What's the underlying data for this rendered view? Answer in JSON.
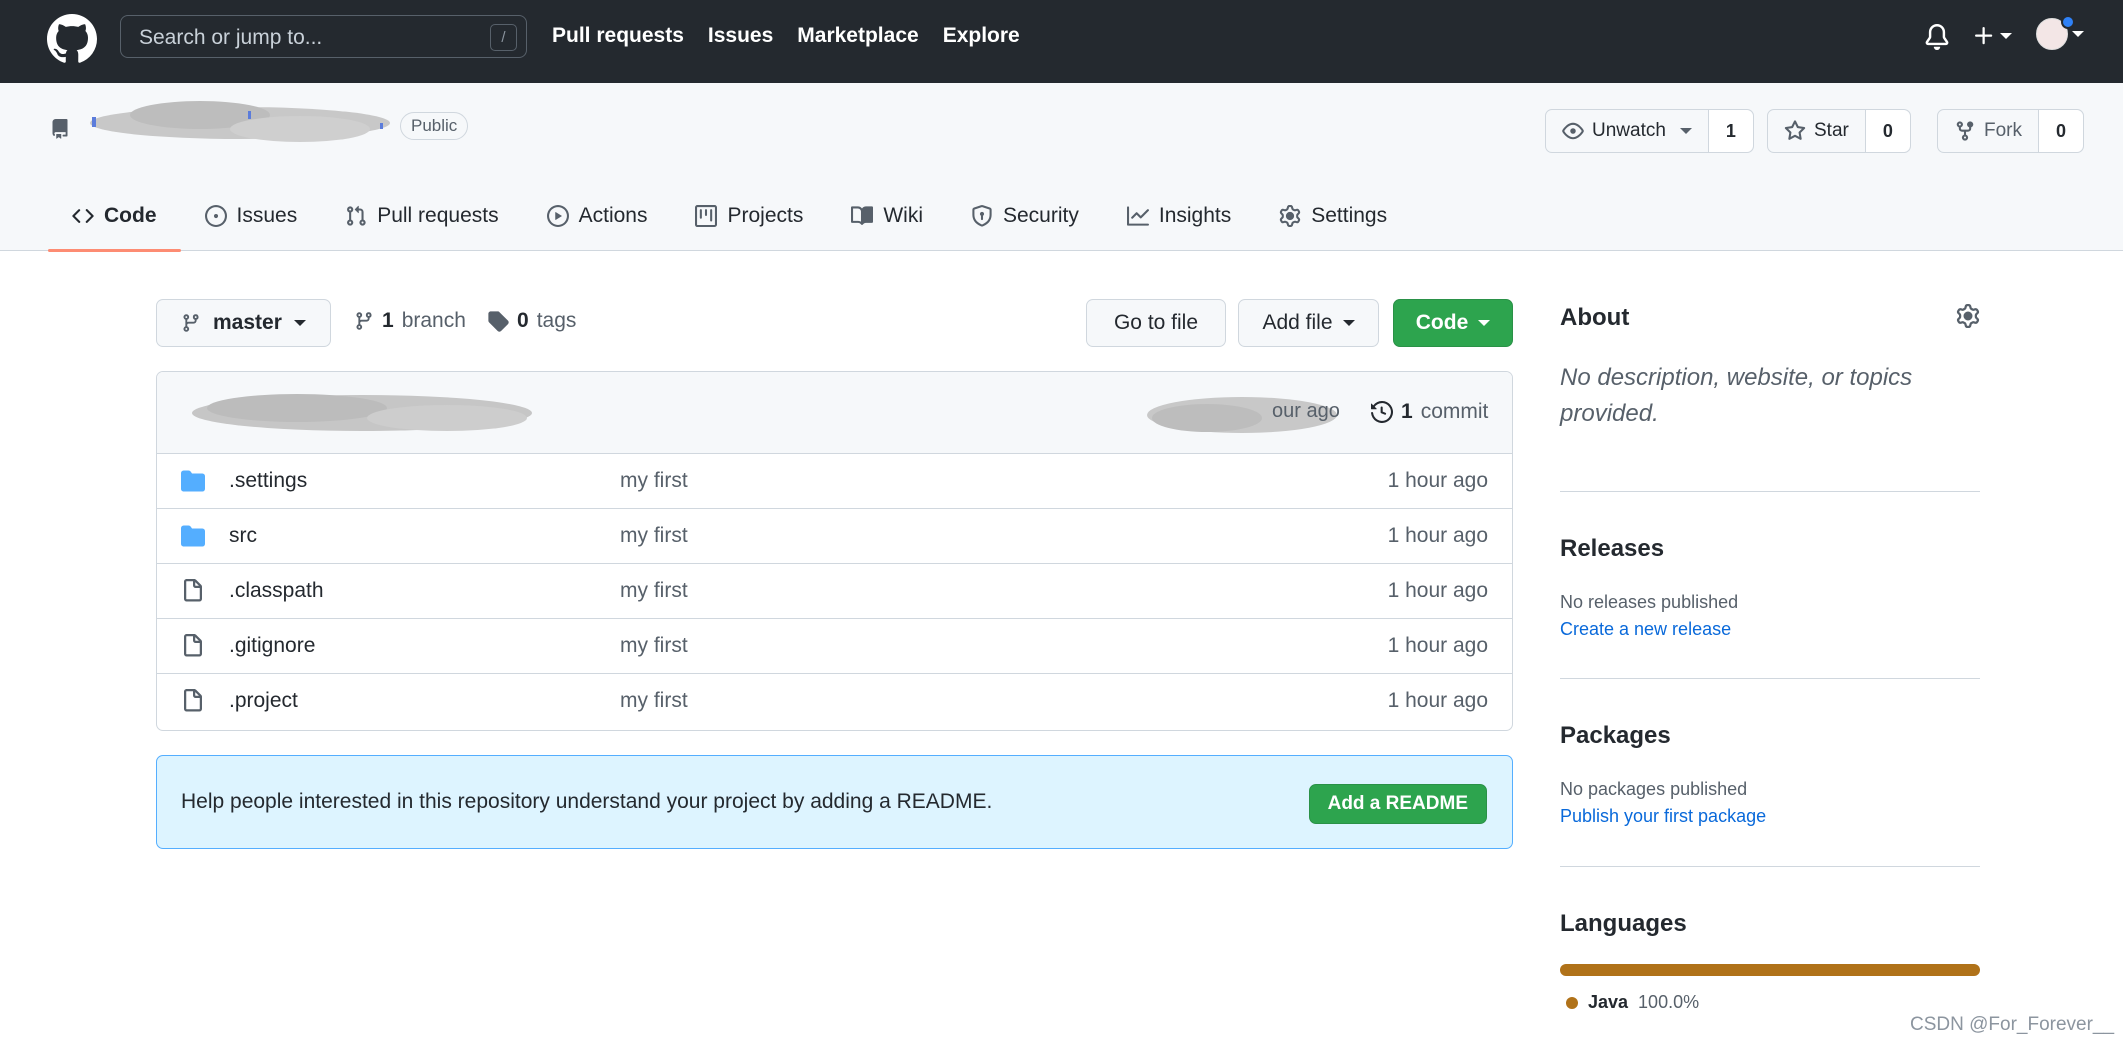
{
  "header": {
    "search_placeholder": "Search or jump to...",
    "search_shortcut": "/",
    "nav": [
      "Pull requests",
      "Issues",
      "Marketplace",
      "Explore"
    ]
  },
  "repo": {
    "visibility": "Public",
    "unwatch_label": "Unwatch",
    "watch_count": "1",
    "star_label": "Star",
    "star_count": "0",
    "fork_label": "Fork",
    "fork_count": "0",
    "tabs": [
      "Code",
      "Issues",
      "Pull requests",
      "Actions",
      "Projects",
      "Wiki",
      "Security",
      "Insights",
      "Settings"
    ],
    "active_tab": "Code"
  },
  "toolbar": {
    "branch": "master",
    "branch_count": "1",
    "branch_label": "branch",
    "tag_count": "0",
    "tag_label": "tags",
    "goto_file": "Go to file",
    "add_file": "Add file",
    "code": "Code"
  },
  "commit": {
    "ago_fragment": "our ago",
    "count": "1",
    "label": "commit"
  },
  "files": [
    {
      "name": ".settings",
      "type": "dir",
      "message": "my first",
      "age": "1 hour ago"
    },
    {
      "name": "src",
      "type": "dir",
      "message": "my first",
      "age": "1 hour ago"
    },
    {
      "name": ".classpath",
      "type": "file",
      "message": "my first",
      "age": "1 hour ago"
    },
    {
      "name": ".gitignore",
      "type": "file",
      "message": "my first",
      "age": "1 hour ago"
    },
    {
      "name": ".project",
      "type": "file",
      "message": "my first",
      "age": "1 hour ago"
    }
  ],
  "readme": {
    "text": "Help people interested in this repository understand your project by adding a README.",
    "button": "Add a README"
  },
  "sidebar": {
    "about_title": "About",
    "about_desc": "No description, website, or topics provided.",
    "releases_title": "Releases",
    "releases_empty": "No releases published",
    "releases_link": "Create a new release",
    "packages_title": "Packages",
    "packages_empty": "No packages published",
    "packages_link": "Publish your first package",
    "languages_title": "Languages",
    "language_name": "Java",
    "language_pct": "100.0%",
    "language_color": "#b07219"
  },
  "watermark": "CSDN @For_Forever__"
}
